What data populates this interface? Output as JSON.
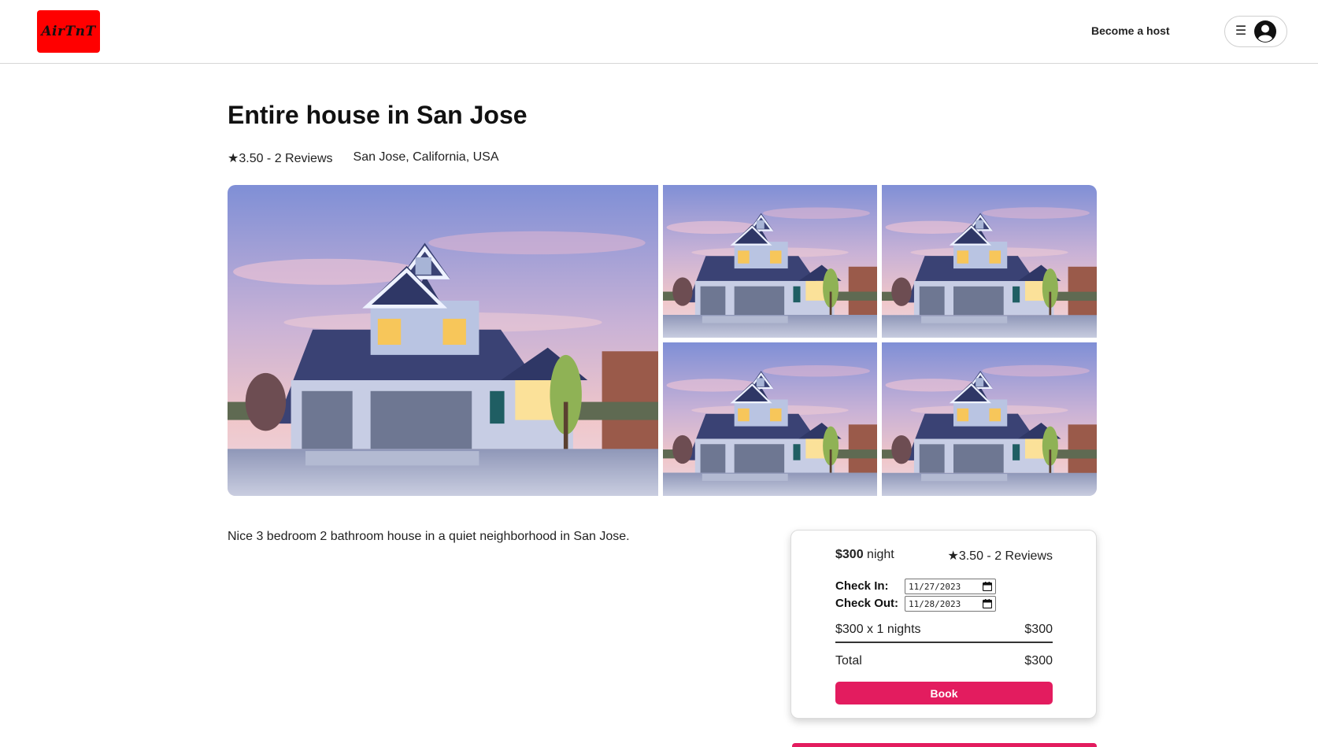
{
  "header": {
    "logo_text": "AirTnT",
    "become_host_label": "Become a host",
    "menu_icon": "hamburger-icon",
    "avatar_icon": "user-circle-icon",
    "logo_color": "#ff0000"
  },
  "listing": {
    "title": "Entire house in San Jose",
    "rating_summary": "★3.50 - 2 Reviews",
    "location": "San Jose, California, USA",
    "description": "Nice 3 bedroom 2 bathroom house in a quiet neighborhood in San Jose."
  },
  "booking": {
    "price": "$300",
    "price_unit": "night",
    "rating_summary": "★3.50 - 2 Reviews",
    "check_in_label": "Check In:",
    "check_in_value": "11/27/2023",
    "check_out_label": "Check Out:",
    "check_out_value": "11/28/2023",
    "nights_label": "$300 x 1 nights",
    "nights_amount": "$300",
    "total_label": "Total",
    "total_amount": "$300",
    "book_label": "Book",
    "accent_color": "#e31c5f"
  }
}
